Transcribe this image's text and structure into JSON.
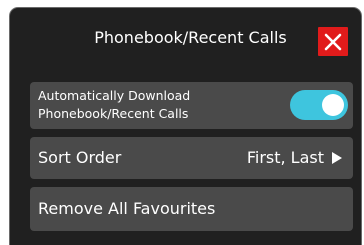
{
  "header": {
    "title": "Phonebook/Recent Calls",
    "close_icon": "close-icon"
  },
  "settings": {
    "auto_download": {
      "label": "Automatically Download\nPhonebook/Recent Calls",
      "enabled": true
    },
    "sort_order": {
      "label": "Sort Order",
      "value": "First, Last",
      "icon": "play-right-icon"
    },
    "remove_favourites": {
      "label": "Remove All Favourites"
    }
  },
  "colors": {
    "panel_background": "#202020",
    "row_background": "#4a4a4a",
    "accent_toggle": "#3ec5de",
    "close_button": "#e11b1b",
    "text": "#ffffff"
  }
}
